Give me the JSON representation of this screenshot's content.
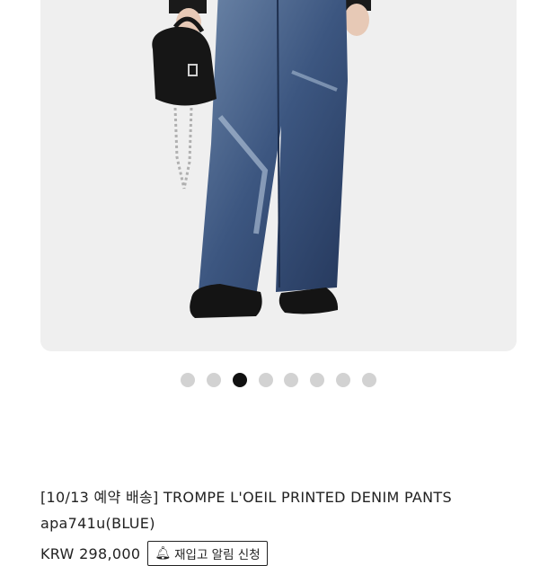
{
  "gallery": {
    "slide_count": 8,
    "active_index": 2
  },
  "product": {
    "title_line1": "[10/13 예약 배송] TROMPE L'OEIL PRINTED DENIM PANTS",
    "title_line2": "apa741u(BLUE)",
    "price": "KRW 298,000",
    "restock_button": "재입고 알림 신청",
    "restock_icon": "bell-icon"
  },
  "colors": {
    "image_bg": "#efefef",
    "dot_inactive": "#d2d2d2",
    "dot_active": "#111111",
    "text": "#222222"
  }
}
